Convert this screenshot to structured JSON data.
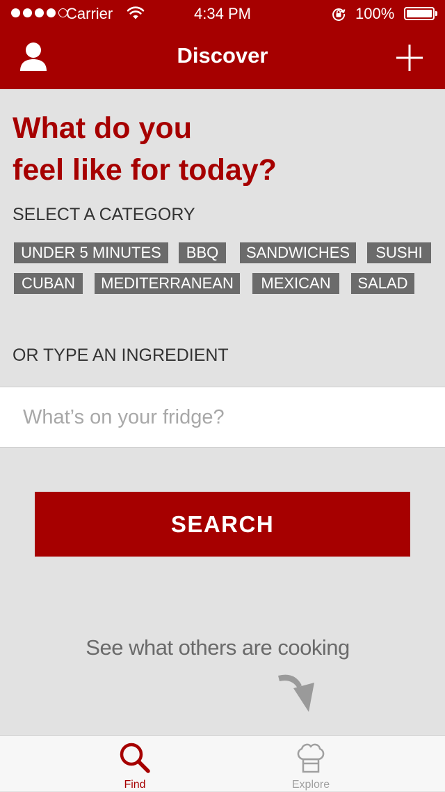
{
  "status_bar": {
    "carrier": "Carrier",
    "time": "4:34 PM",
    "battery": "100%"
  },
  "nav": {
    "title": "Discover",
    "left_icon": "user-icon",
    "right_icon": "plus-icon"
  },
  "headline": {
    "line1": "What do you",
    "line2": "feel like for today?"
  },
  "category_label": "SELECT A CATEGORY",
  "categories": [
    "UNDER 5 MINUTES",
    "BBQ",
    "SANDWICHES",
    "SUSHI",
    "CUBAN",
    "MEDITERRANEAN",
    "MEXICAN",
    "SALAD"
  ],
  "ingredient_label": "OR TYPE AN INGREDIENT",
  "ingredient_input": {
    "placeholder": "What’s on your fridge?",
    "value": ""
  },
  "search_button": "SEARCH",
  "others_link": "See what others are cooking",
  "tabs": [
    {
      "label": "Find",
      "icon": "search-icon",
      "active": true
    },
    {
      "label": "Explore",
      "icon": "chef-hat-icon",
      "active": false
    }
  ],
  "colors": {
    "brand": "#a60000",
    "background": "#e2e2e2",
    "chip": "#6b6b6b",
    "tab_inactive": "#a0a0a0"
  }
}
